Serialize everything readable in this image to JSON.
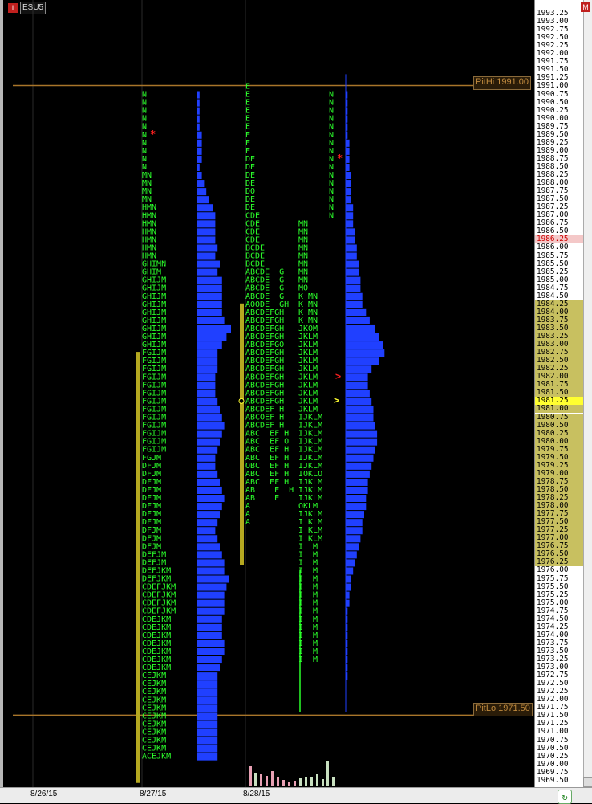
{
  "symbol": {
    "icon_label": "i",
    "name": "ESU5"
  },
  "corner_button": "M",
  "colors": {
    "tpo": "#2bff2b",
    "bar": "#2040ff",
    "value_area": "#b5a820",
    "ref_line": "#a8752a",
    "poc_highlight": "#ffff30",
    "red": "#ff2020"
  },
  "date_labels": [
    "8/26/15",
    "8/27/15",
    "8/28/15"
  ],
  "ref_lines": [
    {
      "label": "PitHi 1991.00",
      "price": 1991.0
    },
    {
      "label": "PitLo 1971.50",
      "price": 1971.5
    }
  ],
  "chart_data": {
    "type": "table",
    "title": "",
    "ylim": [
      1969.5,
      1993.25
    ],
    "tick_step": 0.25,
    "highlight_price": "1986.25",
    "current_price": "1981.25",
    "value_area_prices": [
      "1984.25",
      "1984.00",
      "1983.75",
      "1983.50",
      "1983.25",
      "1983.00",
      "1982.75",
      "1982.50",
      "1982.25",
      "1982.00",
      "1981.75",
      "1981.50",
      "1981.25",
      "1981.00",
      "1980.75",
      "1980.50",
      "1980.25",
      "1980.00",
      "1979.75",
      "1979.50",
      "1979.25",
      "1979.00",
      "1978.75",
      "1978.50",
      "1978.25",
      "1978.00",
      "1977.75",
      "1977.50",
      "1977.25",
      "1977.00",
      "1976.75",
      "1976.50",
      "1976.25"
    ],
    "profiles": [
      {
        "date": "8/27/15",
        "start_price": 1990.75,
        "letters": [
          "N",
          "N",
          "N",
          "N",
          "N",
          "N",
          "N",
          "N",
          "N",
          "N",
          "MN",
          "MN",
          "MN",
          "MN",
          "HMN",
          "HMN",
          "HMN",
          "HMN",
          "HMN",
          "HMN",
          "HMN",
          "GHIMN",
          "GHIM",
          "GHIJM",
          "GHIJM",
          "GHIJM",
          "GHIJM",
          "GHIJM",
          "GHIJM",
          "GHIJM",
          "GHIJM",
          "GHIJM",
          "FGIJM",
          "FGIJM",
          "FGIJM",
          "FGIJM",
          "FGIJM",
          "FGIJM",
          "FGIJM",
          "FGIJM",
          "FGIJM",
          "FGIJM",
          "FGIJM",
          "FGIJM",
          "FGIJM",
          "FGJM",
          "DFJM",
          "DFJM",
          "DFJM",
          "DFJM",
          "DFJM",
          "DFJM",
          "DFJM",
          "DFJM",
          "DFJM",
          "DFJM",
          "DFJM",
          "DEFJM",
          "DEFJM",
          "DEFJKM",
          "DEFJKM",
          "CDEFJKM",
          "CDEFJKM",
          "CDEFJKM",
          "CDEFJKM",
          "CDEJKM",
          "CDEJKM",
          "CDEJKM",
          "CDEJKM",
          "CDEJKM",
          "CDEJKM",
          "CDEJKM",
          "CEJKM",
          "CEJKM",
          "CEJKM",
          "CEJKM",
          "CEJKM",
          "CEJKM",
          "CEJKM",
          "CEJKM",
          "CEJKM",
          "CEJKM",
          "ACEJKM"
        ],
        "bars": [
          1,
          1,
          1,
          1,
          1,
          2,
          2,
          2,
          2,
          1,
          2,
          3,
          4,
          5,
          7,
          8,
          8,
          8,
          8,
          9,
          8,
          10,
          9,
          11,
          11,
          11,
          11,
          11,
          12,
          15,
          13,
          11,
          9,
          9,
          9,
          8,
          8,
          8,
          9,
          10,
          11,
          12,
          11,
          10,
          9,
          8,
          8,
          9,
          10,
          11,
          12,
          11,
          10,
          9,
          8,
          9,
          10,
          11,
          12,
          12,
          14,
          13,
          12,
          12,
          12,
          11,
          11,
          11,
          12,
          12,
          11,
          10,
          9,
          9,
          9,
          9,
          9,
          9,
          9,
          9,
          9,
          9,
          9
        ],
        "va_top": 1982.75,
        "va_bottom": 1969.5
      },
      {
        "date": "8/28/15",
        "start_price": 1991.0,
        "letters": [
          "E",
          "E",
          "E",
          "E",
          "E",
          "E",
          "E",
          "E",
          "E",
          "DE",
          "DE",
          "DE",
          "DE",
          "DO",
          "DE",
          "DE",
          "CDE",
          "CDE",
          "CDE",
          "CDE",
          "BCDE",
          "BCDE",
          "BCDE",
          "ABCDE  G",
          "ABCDE  G",
          "ABCDE  G",
          "ABCDE  G",
          "AOODE  GH",
          "ABCDEFGH",
          "ABCDEFGH",
          "ABCDEFGH",
          "ABCDEFGH",
          "ABCDEFGO",
          "ABCDEFGH",
          "ABCDEFGH",
          "ABCDEFGH",
          "ABCDEFGH",
          "ABCDEFGH",
          "ABCDEFGH",
          "ABCDEFGH",
          "ABCDEF H",
          "ABCOEF H",
          "ABCDEF H",
          "ABC  EF H",
          "ABC  EF O",
          "ABC  EF H",
          "ABC  EF H",
          "OBC  EF H",
          "ABC  EF H",
          "ABC  EF H",
          "AB    E  H",
          "AB    E",
          "A",
          "A",
          "A"
        ],
        "col2_start_price": 1986.75,
        "col2": [
          "MN",
          "MN",
          "MN",
          "MN",
          "MN",
          "MN",
          "MN",
          "MN",
          "MO",
          "K MN",
          "K MN",
          "K MN",
          "K MN",
          "JKOM",
          "JKLM",
          "JKLM",
          "JKLM",
          "JKLM",
          "JKLM",
          "JKLM",
          "JKLM",
          "JKLM",
          "JKLM",
          "JKLM",
          "IJKLM",
          "IJKLM",
          "IJKLM",
          "IJKLM",
          "IJKLM",
          "IJKLM",
          "IJKLM",
          "IOKLO",
          "IJKLM",
          "IJKLM",
          "IJKLM",
          "OKLM",
          "IJKLM",
          "I KLM",
          "I KLM",
          "I KLM",
          "I  M",
          "I  M",
          "I  M",
          "I  M",
          "I  M",
          "I  M",
          "I  M",
          "I  M",
          "I  M",
          "I  M",
          "I  M",
          "I  M",
          "I  M",
          "I  M",
          "I  M"
        ],
        "va_top": 1984.25,
        "va_bottom": 1976.25
      }
    ],
    "right_profile_bars": [
      1,
      1,
      1,
      1,
      1,
      1,
      2,
      2,
      2,
      2,
      3,
      3,
      3,
      3,
      4,
      4,
      4,
      5,
      5,
      6,
      6,
      7,
      7,
      8,
      8,
      9,
      9,
      11,
      13,
      16,
      18,
      20,
      21,
      18,
      14,
      12,
      12,
      13,
      14,
      15,
      15,
      16,
      17,
      17,
      16,
      15,
      14,
      13,
      12,
      12,
      11,
      11,
      10,
      9,
      9,
      8,
      7,
      6,
      5,
      4,
      3,
      3,
      2,
      2,
      1,
      1,
      1,
      1,
      1,
      1,
      1,
      1,
      1
    ],
    "volume_bars": [
      {
        "x": 307,
        "h": 24,
        "c": "#e8a0b4"
      },
      {
        "x": 313,
        "h": 16,
        "c": "#c8e0c0"
      },
      {
        "x": 320,
        "h": 14,
        "c": "#e8a0b4"
      },
      {
        "x": 327,
        "h": 12,
        "c": "#e8a0b4"
      },
      {
        "x": 334,
        "h": 18,
        "c": "#e8a0b4"
      },
      {
        "x": 341,
        "h": 10,
        "c": "#e8a0b4"
      },
      {
        "x": 348,
        "h": 7,
        "c": "#e8a0b4"
      },
      {
        "x": 355,
        "h": 5,
        "c": "#e8a0b4"
      },
      {
        "x": 362,
        "h": 6,
        "c": "#e8a0b4"
      },
      {
        "x": 369,
        "h": 9,
        "c": "#c8e0c0"
      },
      {
        "x": 376,
        "h": 10,
        "c": "#c8e0c0"
      },
      {
        "x": 383,
        "h": 11,
        "c": "#c8e0c0"
      },
      {
        "x": 390,
        "h": 14,
        "c": "#c8e0c0"
      },
      {
        "x": 397,
        "h": 8,
        "c": "#c8e0c0"
      },
      {
        "x": 403,
        "h": 30,
        "c": "#c8e0c0"
      },
      {
        "x": 410,
        "h": 10,
        "c": "#c8e0c0"
      }
    ]
  }
}
